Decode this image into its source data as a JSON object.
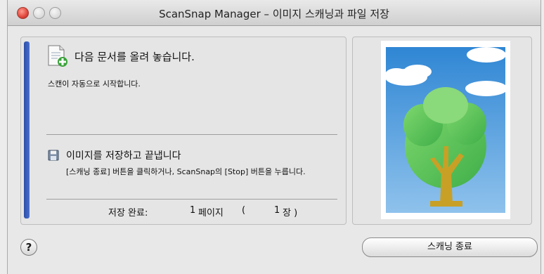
{
  "window": {
    "title": "ScanSnap Manager – 이미지 스캐닝과 파일 저장"
  },
  "left_panel": {
    "heading": "다음 문서를 올려 놓습니다.",
    "subtext": "스캔이 자동으로 시작합니다.",
    "save_heading": "이미지를 저장하고 끝냅니다",
    "save_desc": "[스캐닝 종료] 버튼을 클릭하거나, ScanSnap의 [Stop] 버튼을 누릅니다.",
    "status": {
      "label": "저장 완료:",
      "pages_count": "1",
      "pages_unit": "페이지",
      "paren_open": "(",
      "sheets_count": "1",
      "sheets_unit": "장 )"
    }
  },
  "footer": {
    "help_glyph": "?",
    "end_button_label": "스캐닝 종료"
  },
  "colors": {
    "stripe": "#3558b5",
    "sky": "#3f90d6",
    "tree_green": "#5fc55a",
    "trunk": "#c9a22a"
  },
  "icons": [
    "close-icon",
    "minimize-icon",
    "zoom-icon",
    "document-add-icon",
    "floppy-disk-icon",
    "help-icon"
  ]
}
